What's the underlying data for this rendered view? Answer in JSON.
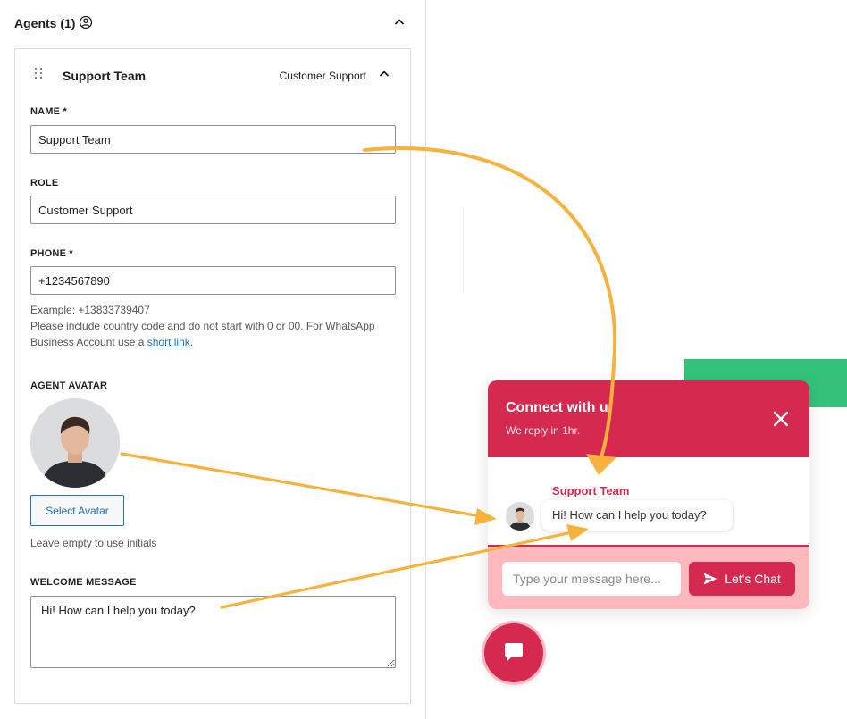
{
  "agents": {
    "title": "Agents (1)"
  },
  "card": {
    "title": "Support Team",
    "role_badge": "Customer Support"
  },
  "fields": {
    "name_label": "NAME *",
    "name_value": "Support Team",
    "role_label": "ROLE",
    "role_value": "Customer Support",
    "phone_label": "PHONE *",
    "phone_value": "+1234567890",
    "phone_example": "Example: +13833739407",
    "phone_help_prefix": "Please include country code and do not start with 0 or 00. For WhatsApp Business Account use a ",
    "phone_help_link": "short link",
    "phone_help_suffix": ".",
    "avatar_label": "AGENT AVATAR",
    "select_avatar": "Select Avatar",
    "avatar_help": "Leave empty to use initials",
    "welcome_label": "WELCOME MESSAGE",
    "welcome_value": "Hi! How can I help you today?"
  },
  "widget": {
    "title": "Connect with u",
    "subtitle": "We reply in 1hr.",
    "agent_name": "Support Team",
    "message": "Hi! How can I help you today?",
    "input_placeholder": "Type your message here...",
    "send_label": "Let's Chat"
  },
  "colors": {
    "brand": "#d62950",
    "footer_bg": "#ffb8bd",
    "link": "#2271b1",
    "green_block": "#34c27a",
    "arrow": "#f7b13d"
  },
  "icons": [
    "user-circle-icon",
    "chevron-up-icon",
    "drag-handle-icon",
    "close-icon",
    "send-icon",
    "chat-bubble-icon"
  ]
}
